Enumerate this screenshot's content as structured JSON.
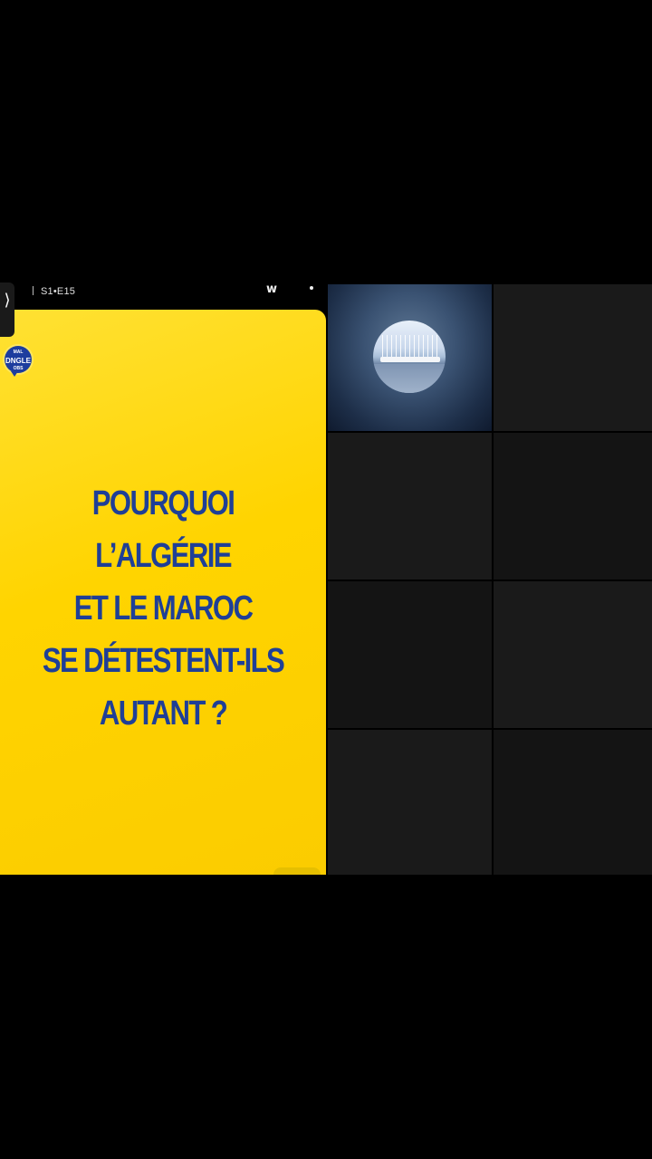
{
  "player": {
    "side_tab_glyph": "⟩",
    "episode_label": "S1•E15",
    "top_icon_w": "w",
    "top_menu_dot": "•"
  },
  "card": {
    "logo": {
      "top": "MAL",
      "middle": "DNGLE",
      "bottom": "OBS"
    },
    "headline": [
      "POURQUOI",
      "L’ALGÉRIE",
      "ET LE MAROC",
      "SE DÉTESTENT-ILS",
      "AUTANT ?"
    ],
    "background_color": "#ffd400",
    "text_color": "#1f3f96"
  },
  "grid": {
    "thumbnail_description_icon": "harbor-thumbnail"
  }
}
